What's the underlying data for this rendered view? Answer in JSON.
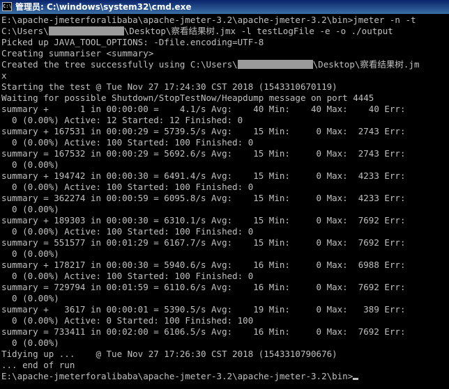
{
  "window": {
    "title": "管理员: C:\\windows\\system32\\cmd.exe",
    "icon_name": "cmd-icon",
    "icon_text": "C:\\"
  },
  "console": {
    "lines": [
      {
        "text": "E:\\apache-jmeterforalibaba\\apache-jmeter-3.2\\apache-jmeter-3.2\\bin>jmeter -n -t"
      },
      {
        "parts": [
          {
            "text": "C:\\Users\\"
          },
          {
            "redact": true
          },
          {
            "text": "\\Desktop\\察看结果树.jmx -l testLogFile -e -o ./output"
          }
        ]
      },
      {
        "text": "Picked up JAVA_TOOL_OPTIONS: -Dfile.encoding=UTF-8"
      },
      {
        "text": "Creating summariser <summary>"
      },
      {
        "parts": [
          {
            "text": "Created the tree successfully using C:\\Users\\"
          },
          {
            "redact": true
          },
          {
            "text": "\\Desktop\\察看结果树.jm"
          }
        ]
      },
      {
        "text": "x"
      },
      {
        "text": "Starting the test @ Tue Nov 27 17:24:30 CST 2018 (1543310670119)"
      },
      {
        "text": "Waiting for possible Shutdown/StopTestNow/Heapdump message on port 4445"
      },
      {
        "text": "summary +      1 in 00:00:00 =    4.1/s Avg:    40 Min:    40 Max:    40 Err:"
      },
      {
        "text": "  0 (0.00%) Active: 12 Started: 12 Finished: 0"
      },
      {
        "text": "summary + 167531 in 00:00:29 = 5739.5/s Avg:    15 Min:     0 Max:  2743 Err:"
      },
      {
        "text": "  0 (0.00%) Active: 100 Started: 100 Finished: 0"
      },
      {
        "text": "summary = 167532 in 00:00:29 = 5692.6/s Avg:    15 Min:     0 Max:  2743 Err:"
      },
      {
        "text": "  0 (0.00%)"
      },
      {
        "text": "summary + 194742 in 00:00:30 = 6491.4/s Avg:    15 Min:     0 Max:  4233 Err:"
      },
      {
        "text": "  0 (0.00%) Active: 100 Started: 100 Finished: 0"
      },
      {
        "text": "summary = 362274 in 00:00:59 = 6095.8/s Avg:    15 Min:     0 Max:  4233 Err:"
      },
      {
        "text": "  0 (0.00%)"
      },
      {
        "text": "summary + 189303 in 00:00:30 = 6310.1/s Avg:    15 Min:     0 Max:  7692 Err:"
      },
      {
        "text": "  0 (0.00%) Active: 100 Started: 100 Finished: 0"
      },
      {
        "text": "summary = 551577 in 00:01:29 = 6167.7/s Avg:    15 Min:     0 Max:  7692 Err:"
      },
      {
        "text": "  0 (0.00%)"
      },
      {
        "text": "summary + 178217 in 00:00:30 = 5940.6/s Avg:    16 Min:     0 Max:  6988 Err:"
      },
      {
        "text": "  0 (0.00%) Active: 100 Started: 100 Finished: 0"
      },
      {
        "text": "summary = 729794 in 00:01:59 = 6110.6/s Avg:    16 Min:     0 Max:  7692 Err:"
      },
      {
        "text": "  0 (0.00%)"
      },
      {
        "text": "summary +   3617 in 00:00:01 = 5390.5/s Avg:    19 Min:     0 Max:   389 Err:"
      },
      {
        "text": "  0 (0.00%) Active: 0 Started: 100 Finished: 100"
      },
      {
        "text": "summary = 733411 in 00:02:00 = 6106.5/s Avg:    16 Min:     0 Max:  7692 Err:"
      },
      {
        "text": "  0 (0.00%)"
      },
      {
        "text": "Tidying up ...    @ Tue Nov 27 17:26:30 CST 2018 (1543310790676)"
      },
      {
        "text": "... end of run"
      },
      {
        "text": "E:\\apache-jmeterforalibaba\\apache-jmeter-3.2\\apache-jmeter-3.2\\bin>",
        "cursor": true
      }
    ]
  },
  "colors": {
    "background": "#000000",
    "text": "#c0c0c0",
    "titlebar_start": "#0a246a",
    "titlebar_end": "#3a6ea5",
    "redaction": "#9a9a9a"
  }
}
